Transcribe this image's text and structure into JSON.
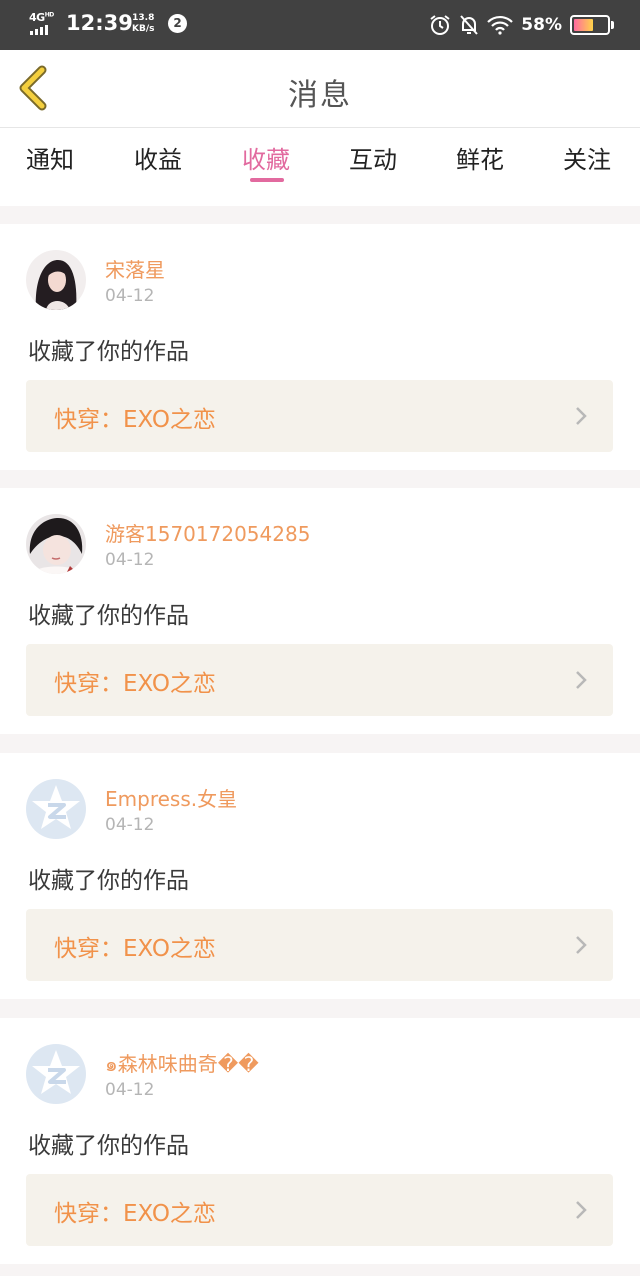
{
  "status_bar": {
    "network": "4G",
    "network_sup": "HD",
    "time": "12:39",
    "speed_value": "13.8",
    "speed_unit": "KB/s",
    "notification_count": "2",
    "battery_percent": "58%",
    "battery_level": 0.58
  },
  "header": {
    "title": "消息"
  },
  "tabs": [
    {
      "label": "通知"
    },
    {
      "label": "收益"
    },
    {
      "label": "收藏"
    },
    {
      "label": "互动"
    },
    {
      "label": "鲜花"
    },
    {
      "label": "关注"
    }
  ],
  "active_tab": "收藏",
  "colors": {
    "accent": "#e26a9f",
    "username": "#ef9a5e",
    "work_title": "#f1924a",
    "card_link_bg": "#f5f2eb"
  },
  "items": [
    {
      "username": "宋落星",
      "date": "04-12",
      "action": "收藏了你的作品",
      "work_title": "快穿：EXO之恋",
      "avatar": "photo-girl-dark-hair"
    },
    {
      "username": "游客1570172054285",
      "date": "04-12",
      "action": "收藏了你的作品",
      "work_title": "快穿：EXO之恋",
      "avatar": "photo-girl-short-hair"
    },
    {
      "username": "Empress.女皇",
      "date": "04-12",
      "action": "收藏了你的作品",
      "work_title": "快穿：EXO之恋",
      "avatar": "default-qq-star-icon"
    },
    {
      "username": "๑森林味曲奇��",
      "date": "04-12",
      "action": "收藏了你的作品",
      "work_title": "快穿：EXO之恋",
      "avatar": "default-qq-star-icon"
    }
  ]
}
